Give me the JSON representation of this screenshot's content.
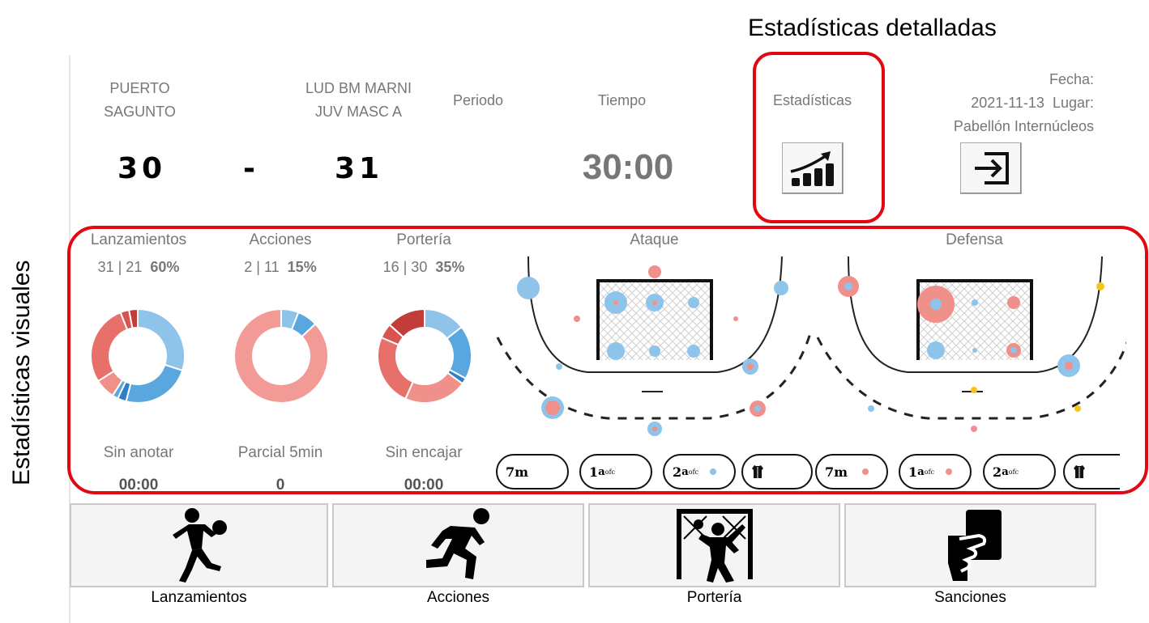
{
  "callouts": {
    "detailed": "Estadísticas detalladas",
    "visual": "Estadísticas visuales"
  },
  "header": {
    "home_team": "PUERTO\nSAGUNTO",
    "away_team": "LUD BM MARNI\nJUV MASC A",
    "home_score": "30",
    "separator": "-",
    "away_score": "31",
    "period_label": "Periodo",
    "time_label": "Tiempo",
    "time_value": "30:00",
    "stats_label": "Estadísticas",
    "date_label": "Fecha:",
    "date_value": "2021-11-13",
    "place_label": "Lugar:",
    "place_value": "Pabellón Internúcleos"
  },
  "stats": [
    {
      "title": "Lanzamientos",
      "counts": "31 | 21",
      "pct": "60%",
      "footer_label": "Sin anotar",
      "footer_value": "00:00",
      "donut": [
        {
          "value": 30,
          "color": "#8ec3ea"
        },
        {
          "value": 24,
          "color": "#5aa6de"
        },
        {
          "value": 3,
          "color": "#2f7fc4"
        },
        {
          "value": 2,
          "color": "#5aa6de"
        },
        {
          "value": 7,
          "color": "#f0908a"
        },
        {
          "value": 28,
          "color": "#e8706a"
        },
        {
          "value": 3,
          "color": "#d9534f"
        },
        {
          "value": 3,
          "color": "#c23d3a"
        }
      ]
    },
    {
      "title": "Acciones",
      "counts": "2 | 11",
      "pct": "15%",
      "footer_label": "Parcial 5min",
      "footer_value": "0",
      "donut": [
        {
          "value": 6,
          "color": "#8ec3ea"
        },
        {
          "value": 7,
          "color": "#5aa6de"
        },
        {
          "value": 87,
          "color": "#f29b96"
        }
      ]
    },
    {
      "title": "Portería",
      "counts": "16 | 30",
      "pct": "35%",
      "footer_label": "Sin encajar",
      "footer_value": "00:00",
      "donut": [
        {
          "value": 14,
          "color": "#8ec3ea"
        },
        {
          "value": 18,
          "color": "#5aa6de"
        },
        {
          "value": 2,
          "color": "#2f7fc4"
        },
        {
          "value": 21,
          "color": "#f0908a"
        },
        {
          "value": 24,
          "color": "#e8706a"
        },
        {
          "value": 5,
          "color": "#d9534f"
        },
        {
          "value": 13,
          "color": "#c23d3a"
        }
      ]
    }
  ],
  "courts": {
    "attack_label": "Ataque",
    "defense_label": "Defensa"
  },
  "filters": [
    {
      "main": "7m",
      "sup": "",
      "sub": "",
      "dot": ""
    },
    {
      "main": "1",
      "sup": "a",
      "sub": "ofc",
      "dot": ""
    },
    {
      "main": "2",
      "sup": "a",
      "sub": "ofc",
      "dot": "#8ec3ea"
    },
    {
      "main": "",
      "sup": "",
      "sub": "",
      "dot": ""
    },
    {
      "main": "7m",
      "sup": "",
      "sub": "",
      "dot": "#f0908a"
    },
    {
      "main": "1",
      "sup": "a",
      "sub": "ofc",
      "dot": "#f0908a"
    },
    {
      "main": "2",
      "sup": "a",
      "sub": "ofc",
      "dot": ""
    },
    {
      "main": "",
      "sup": "",
      "sub": "",
      "dot": ""
    }
  ],
  "actions": [
    {
      "label": "Lanzamientos",
      "icon": "thrower-icon"
    },
    {
      "label": "Acciones",
      "icon": "runner-icon"
    },
    {
      "label": "Portería",
      "icon": "goalkeeper-icon"
    },
    {
      "label": "Sanciones",
      "icon": "card-icon"
    }
  ],
  "colors": {
    "accent_red": "#e30613",
    "blue": "#8ec3ea",
    "red": "#f0908a",
    "yellow": "#f5c518"
  }
}
